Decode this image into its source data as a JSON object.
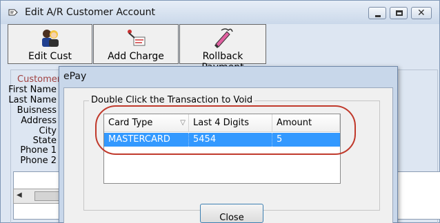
{
  "parent_window": {
    "title": "Edit A/R Customer Account",
    "toolbar": [
      {
        "label": "Edit Cust",
        "icon": "people-icon"
      },
      {
        "label": "Add Charge",
        "icon": "add-charge-icon"
      },
      {
        "label": "Rollback Payment",
        "icon": "rollback-icon"
      }
    ],
    "group_title": "Customer",
    "field_labels": [
      "First Name",
      "Last Name",
      "Buisness",
      "Address",
      "City",
      "State",
      "Phone 1",
      "Phone 2"
    ]
  },
  "dialog": {
    "title": "ePay",
    "group_title": "Double Click the Transaction to Void",
    "columns": [
      "Card Type",
      "Last 4 Digits",
      "Amount"
    ],
    "rows": [
      {
        "card_type": "MASTERCARD",
        "last4": "5454",
        "amount": "5"
      }
    ],
    "close_label": "Close"
  },
  "colors": {
    "selection": "#3399ff",
    "highlight_ring": "#c0392b"
  }
}
